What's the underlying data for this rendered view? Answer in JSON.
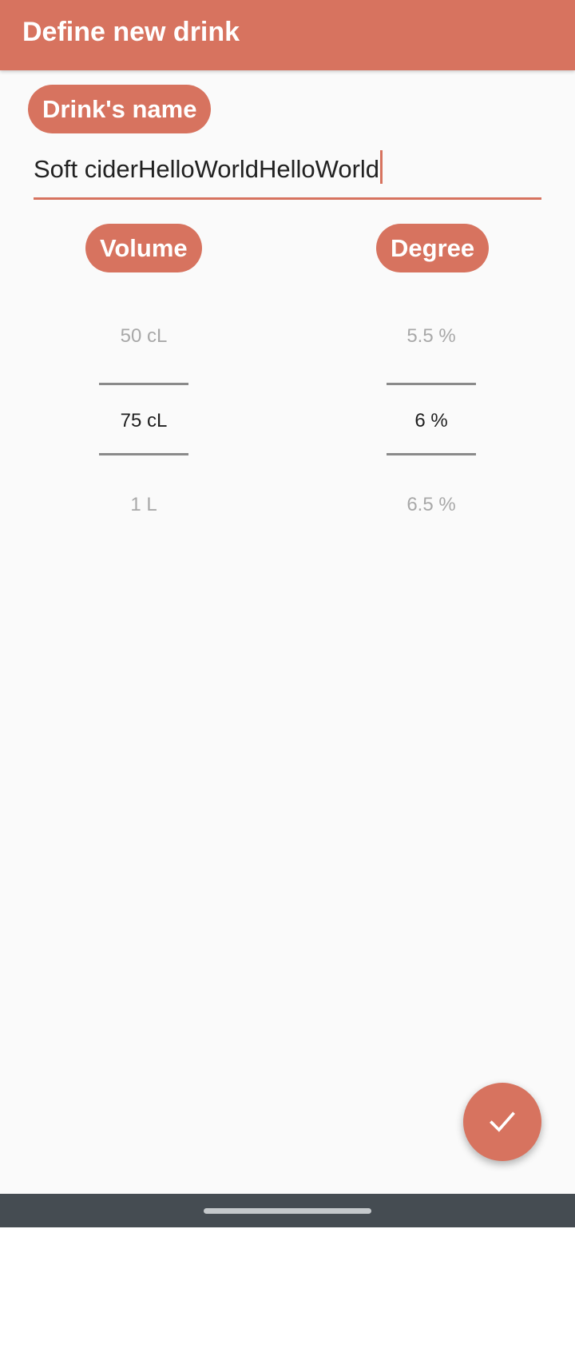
{
  "app_bar": {
    "title": "Define new drink",
    "color": "#d7735f"
  },
  "name_section": {
    "label": "Drink's name",
    "value": "Soft ciderHelloWorldHelloWorld"
  },
  "volume_picker": {
    "label": "Volume",
    "previous": "50 cL",
    "selected": "75 cL",
    "next": "1 L"
  },
  "degree_picker": {
    "label": "Degree",
    "previous": "5.5 %",
    "selected": "6 %",
    "next": "6.5 %"
  },
  "fab": {
    "icon": "check-icon"
  },
  "colors": {
    "accent": "#d7735f",
    "background": "#fafafa",
    "nav_bar": "#454c52"
  }
}
